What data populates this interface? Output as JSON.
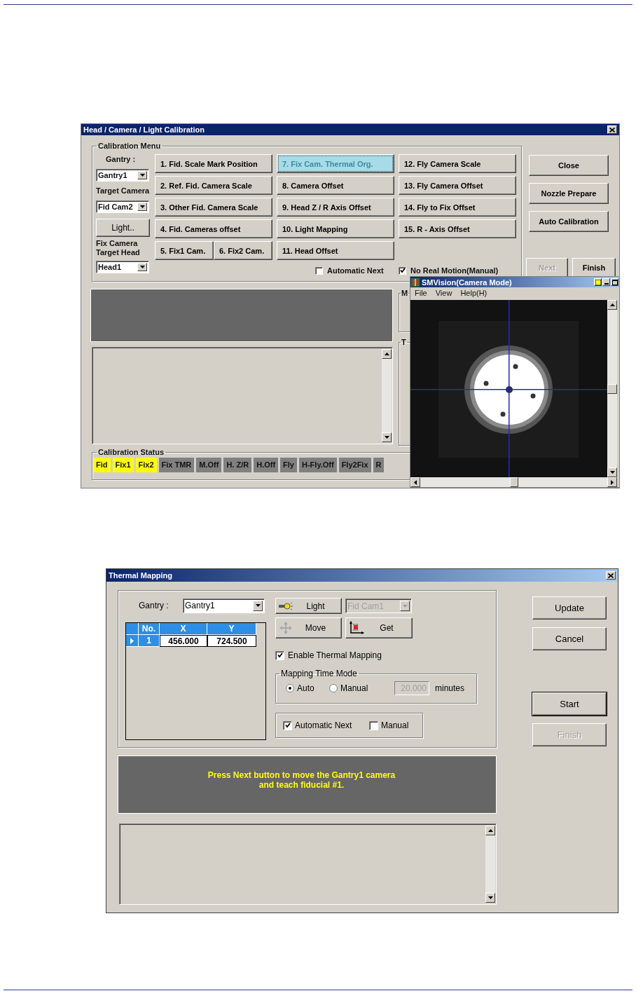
{
  "calibration_window": {
    "title": "Head / Camera / Light Calibration",
    "menu_group": {
      "label": "Calibration Menu",
      "gantry": {
        "label": "Gantry :",
        "value": "Gantry1"
      },
      "target_camera": {
        "label": "Target Camera",
        "value": "Fid Cam2"
      },
      "light_button": "Light..",
      "fix_camera_head": {
        "label": "Fix Camera Target Head",
        "value": "Head1"
      },
      "columns": [
        [
          [
            {
              "label": "1. Fid. Scale Mark Position",
              "selected": false
            }
          ],
          [
            {
              "label": "2. Ref. Fid. Camera Scale",
              "selected": false
            }
          ],
          [
            {
              "label": "3. Other Fid. Camera Scale",
              "selected": false
            }
          ],
          [
            {
              "label": "4. Fid. Cameras offset",
              "selected": false
            }
          ],
          [
            {
              "label": "5. Fix1 Cam.",
              "selected": false
            },
            {
              "label": "6. Fix2 Cam.",
              "selected": false
            }
          ]
        ],
        [
          [
            {
              "label": "7. Fix Cam. Thermal Org.",
              "selected": true
            }
          ],
          [
            {
              "label": "8. Camera Offset",
              "selected": false
            }
          ],
          [
            {
              "label": "9. Head Z / R Axis Offset",
              "selected": false
            }
          ],
          [
            {
              "label": "10. Light Mapping",
              "selected": false
            }
          ],
          [
            {
              "label": "11. Head Offset",
              "selected": false
            }
          ]
        ],
        [
          [
            {
              "label": "12. Fly Camera Scale",
              "selected": false
            }
          ],
          [
            {
              "label": "13. Fly Camera Offset",
              "selected": false
            }
          ],
          [
            {
              "label": "14. Fly to Fix Offset",
              "selected": false
            }
          ],
          [
            {
              "label": "15. R - Axis Offset",
              "selected": false
            }
          ]
        ]
      ],
      "options": [
        {
          "label": "Automatic Next",
          "checked": false
        },
        {
          "label": "No Real Motion(Manual)",
          "checked": true
        }
      ]
    },
    "side_buttons": [
      {
        "label": "Close",
        "disabled": false
      },
      {
        "label": "Nozzle Prepare",
        "disabled": false
      },
      {
        "label": "Auto Calibration",
        "disabled": false
      }
    ],
    "step_buttons": [
      {
        "label": "Next",
        "disabled": true
      },
      {
        "label": "Finish",
        "disabled": false
      }
    ],
    "hidden_groups": [
      "M",
      "T"
    ],
    "status_group": {
      "label": "Calibration Status",
      "items": [
        {
          "label": "Fid",
          "done": true
        },
        {
          "label": "Fix1",
          "done": true
        },
        {
          "label": "Fix2",
          "done": true
        },
        {
          "label": "Fix TMR",
          "done": false
        },
        {
          "label": "M.Off",
          "done": false
        },
        {
          "label": "H. Z/R",
          "done": false
        },
        {
          "label": "H.Off",
          "done": false
        },
        {
          "label": "Fly",
          "done": false
        },
        {
          "label": "H-Fly.Off",
          "done": false
        },
        {
          "label": "Fly2Fix",
          "done": false
        },
        {
          "label": "R",
          "done": false
        }
      ]
    }
  },
  "camera_window": {
    "title": "SMVision(Camera Mode)",
    "menu": [
      "File",
      "View",
      "Help(H)"
    ]
  },
  "thermal_window": {
    "title": "Thermal Mapping",
    "gantry": {
      "label": "Gantry :",
      "value": "Gantry1"
    },
    "table": {
      "columns": [
        "No.",
        "X",
        "Y"
      ],
      "rows": [
        {
          "cells": [
            "1",
            "456.000",
            "724.500"
          ],
          "selected": true
        }
      ]
    },
    "light_button": "Light",
    "camera_select": {
      "value": "Fid Cam1",
      "disabled": true
    },
    "move_button": "Move",
    "get_button": "Get",
    "enable_thermal_mapping": {
      "label": "Enable Thermal Mapping",
      "checked": true
    },
    "time_mode": {
      "label": "Mapping Time Mode",
      "options": [
        {
          "label": "Auto",
          "selected": true
        },
        {
          "label": "Manual",
          "selected": false
        }
      ],
      "minutes": {
        "value": "20.000",
        "disabled": true
      },
      "unit": "minutes"
    },
    "next_options": [
      {
        "label": "Automatic Next",
        "checked": true
      },
      {
        "label": "Manual",
        "checked": false
      }
    ],
    "side_buttons": [
      {
        "label": "Update",
        "disabled": false,
        "default": false
      },
      {
        "label": "Cancel",
        "disabled": false,
        "default": false
      }
    ],
    "run_buttons": [
      {
        "label": "Start",
        "disabled": false,
        "default": true
      },
      {
        "label": "Finish",
        "disabled": true,
        "default": false
      }
    ],
    "message": "Press Next button to move the Gantry1 camera\nand teach fiducial #1."
  }
}
